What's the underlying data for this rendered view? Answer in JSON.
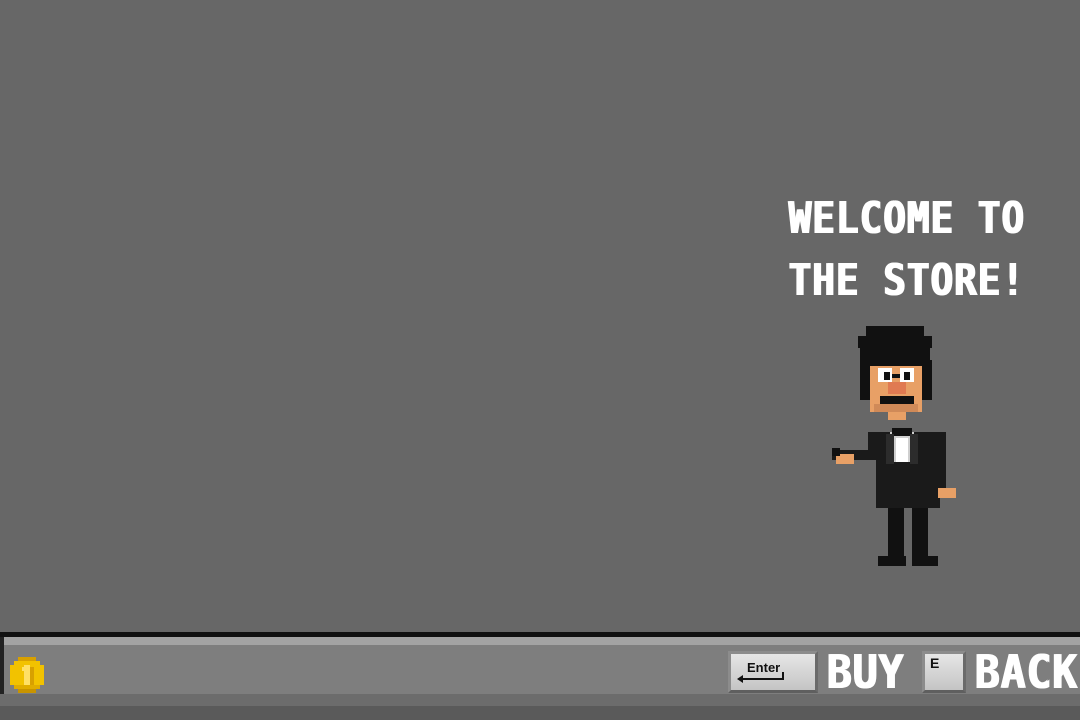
{
  "greeting": {
    "line1": "WELCOME TO",
    "line2": "THE STORE!"
  },
  "shopkeeper": {
    "icon": "shopkeeper-sprite"
  },
  "bottom_bar": {
    "coin_icon": "gold-coin-icon",
    "buy": {
      "key_label": "Enter",
      "action_label": "BUY"
    },
    "back": {
      "key_label": "E",
      "action_label": "BACK"
    }
  },
  "colors": {
    "background": "#676767",
    "bar": "#7e7e7e",
    "text": "#ffffff",
    "coin": "#f2c200"
  }
}
